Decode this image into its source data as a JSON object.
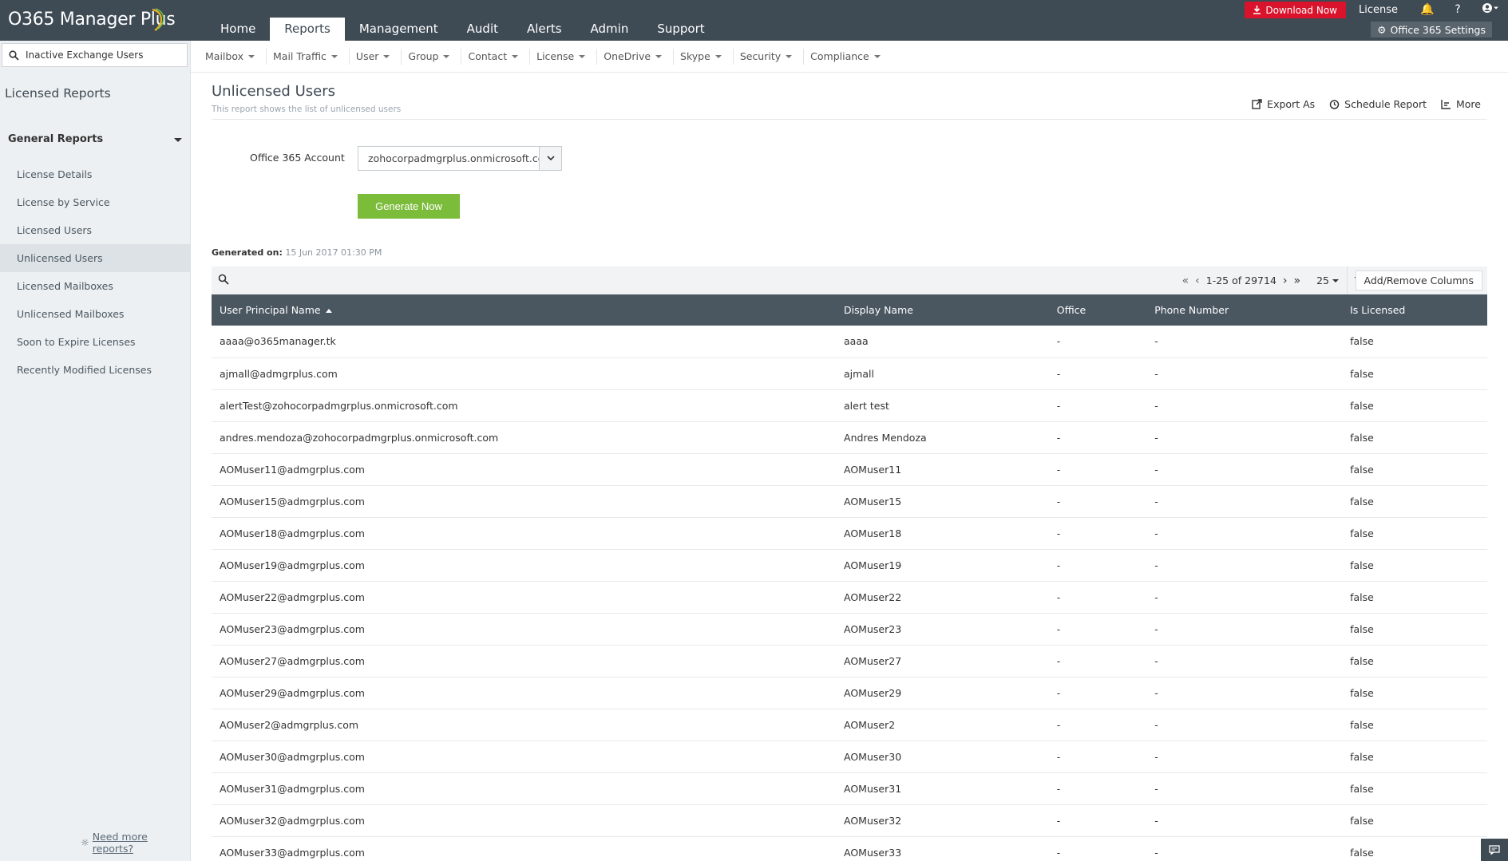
{
  "app": {
    "logo_text": "O365 Manager Plus",
    "download_label": "Download Now",
    "license_label": "License",
    "help_label": "?",
    "settings_label": "Office 365 Settings"
  },
  "main_nav": [
    {
      "label": "Home",
      "active": false
    },
    {
      "label": "Reports",
      "active": true
    },
    {
      "label": "Management",
      "active": false
    },
    {
      "label": "Audit",
      "active": false
    },
    {
      "label": "Alerts",
      "active": false
    },
    {
      "label": "Admin",
      "active": false
    },
    {
      "label": "Support",
      "active": false
    }
  ],
  "sub_nav": [
    "Mailbox",
    "Mail Traffic",
    "User",
    "Group",
    "Contact",
    "License",
    "OneDrive",
    "Skype",
    "Security",
    "Compliance"
  ],
  "sidebar": {
    "search_value": "Inactive Exchange Users",
    "title": "Licensed Reports",
    "group_label": "General Reports",
    "items": [
      {
        "label": "License Details",
        "active": false
      },
      {
        "label": "License by Service",
        "active": false
      },
      {
        "label": "Licensed Users",
        "active": false
      },
      {
        "label": "Unlicensed Users",
        "active": true
      },
      {
        "label": "Licensed Mailboxes",
        "active": false
      },
      {
        "label": "Unlicensed Mailboxes",
        "active": false
      },
      {
        "label": "Soon to Expire Licenses",
        "active": false
      },
      {
        "label": "Recently Modified Licenses",
        "active": false
      }
    ],
    "need_more_label": "Need more reports?"
  },
  "page": {
    "title": "Unlicensed Users",
    "subtitle": "This report shows the list of unlicensed users",
    "export_label": "Export As",
    "schedule_label": "Schedule Report",
    "more_label": "More",
    "account_label": "Office 365 Account",
    "account_value": "zohocorpadmgrplus.onmicrosoft.com",
    "generate_label": "Generate Now",
    "generated_label": "Generated on:",
    "generated_value": "15 Jun 2017 01:30 PM"
  },
  "toolbar": {
    "range_label": "1-25 of 29714",
    "page_size": "25",
    "add_remove_label": "Add/Remove Columns"
  },
  "table": {
    "columns": [
      "User Principal Name",
      "Display Name",
      "Office",
      "Phone Number",
      "Is Licensed"
    ],
    "rows": [
      [
        "aaaa@o365manager.tk",
        "aaaa",
        "-",
        "-",
        "false"
      ],
      [
        "ajmall@admgrplus.com",
        "ajmall",
        "-",
        "-",
        "false"
      ],
      [
        "alertTest@zohocorpadmgrplus.onmicrosoft.com",
        "alert test",
        "-",
        "-",
        "false"
      ],
      [
        "andres.mendoza@zohocorpadmgrplus.onmicrosoft.com",
        "Andres Mendoza",
        "-",
        "-",
        "false"
      ],
      [
        "AOMuser11@admgrplus.com",
        "AOMuser11",
        "-",
        "-",
        "false"
      ],
      [
        "AOMuser15@admgrplus.com",
        "AOMuser15",
        "-",
        "-",
        "false"
      ],
      [
        "AOMuser18@admgrplus.com",
        "AOMuser18",
        "-",
        "-",
        "false"
      ],
      [
        "AOMuser19@admgrplus.com",
        "AOMuser19",
        "-",
        "-",
        "false"
      ],
      [
        "AOMuser22@admgrplus.com",
        "AOMuser22",
        "-",
        "-",
        "false"
      ],
      [
        "AOMuser23@admgrplus.com",
        "AOMuser23",
        "-",
        "-",
        "false"
      ],
      [
        "AOMuser27@admgrplus.com",
        "AOMuser27",
        "-",
        "-",
        "false"
      ],
      [
        "AOMuser29@admgrplus.com",
        "AOMuser29",
        "-",
        "-",
        "false"
      ],
      [
        "AOMuser2@admgrplus.com",
        "AOMuser2",
        "-",
        "-",
        "false"
      ],
      [
        "AOMuser30@admgrplus.com",
        "AOMuser30",
        "-",
        "-",
        "false"
      ],
      [
        "AOMuser31@admgrplus.com",
        "AOMuser31",
        "-",
        "-",
        "false"
      ],
      [
        "AOMuser32@admgrplus.com",
        "AOMuser32",
        "-",
        "-",
        "false"
      ],
      [
        "AOMuser33@admgrplus.com",
        "AOMuser33",
        "-",
        "-",
        "false"
      ]
    ]
  },
  "colors": {
    "topbar": "#3e4a54",
    "download": "#d8132b",
    "generate": "#7cbc3b",
    "table_header": "#4a5660"
  }
}
